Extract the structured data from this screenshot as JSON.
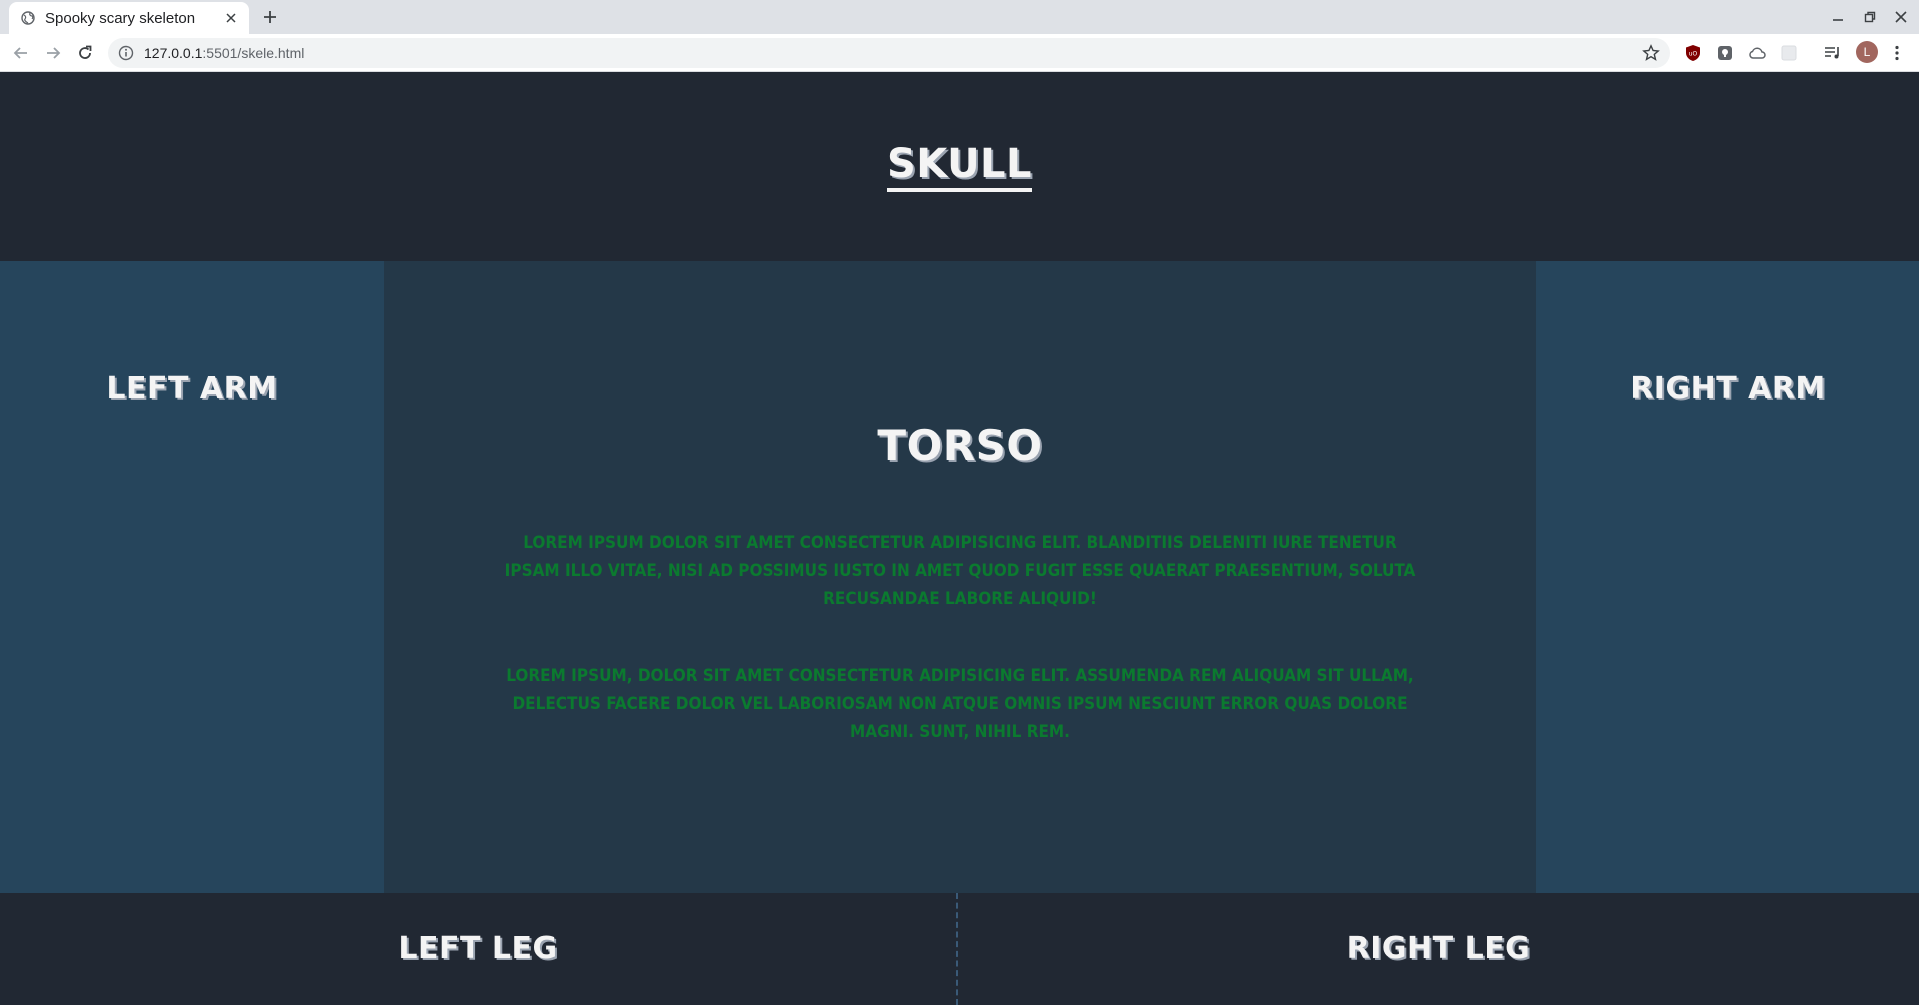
{
  "browser": {
    "tab_title": "Spooky scary skeleton",
    "url_host": "127.0.0.1",
    "url_rest": ":5501/skele.html",
    "avatar_letter": "L",
    "accent_color": "#a1665e"
  },
  "page": {
    "skull": "Skull",
    "left_arm": "Left Arm",
    "right_arm": "Right Arm",
    "torso": {
      "title": "Torso",
      "paragraph_1": "Lorem ipsum dolor sit amet consectetur adipisicing elit. Blanditiis deleniti iure tenetur ipsam illo vitae, nisi ad possimus iusto in amet quod fugit esse quaerat praesentium, soluta recusandae labore aliquid!",
      "paragraph_2": "Lorem ipsum, dolor sit amet consectetur adipisicing elit. Assumenda rem aliquam sit ullam, delectus facere dolor vel laboriosam non atque omnis ipsum nesciunt error quas dolore magni. Sunt, nihil rem."
    },
    "left_leg": "Left Leg",
    "right_leg": "Right Leg",
    "colors": {
      "header_bg": "#212833",
      "arm_bg": "#26455c",
      "torso_bg": "#243848",
      "paragraph_text": "#0b7a2f"
    }
  }
}
